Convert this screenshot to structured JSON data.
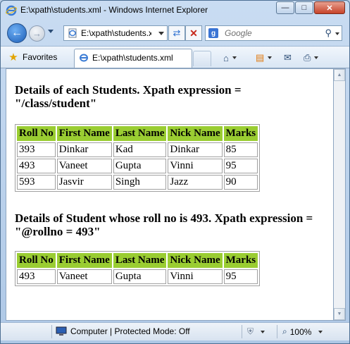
{
  "window": {
    "title": "E:\\xpath\\students.xml - Windows Internet Explorer",
    "minimize_icon": "minimize-icon",
    "maximize_icon": "maximize-icon",
    "close_icon": "close-icon"
  },
  "nav": {
    "address": "E:\\xpath\\students.x",
    "search_placeholder": "Google",
    "search_provider_icon": "google-icon"
  },
  "favbar": {
    "favorites_label": "Favorites",
    "tab_title": "E:\\xpath\\students.xml"
  },
  "page": {
    "heading1": "Details of each Students. Xpath expression = \"/class/student\"",
    "heading2": "Details of Student whose roll no is 493. Xpath expression = \"@rollno = 493\"",
    "table_headers": [
      "Roll No",
      "First Name",
      "Last Name",
      "Nick Name",
      "Marks"
    ],
    "table1_rows": [
      [
        "393",
        "Dinkar",
        "Kad",
        "Dinkar",
        "85"
      ],
      [
        "493",
        "Vaneet",
        "Gupta",
        "Vinni",
        "95"
      ],
      [
        "593",
        "Jasvir",
        "Singh",
        "Jazz",
        "90"
      ]
    ],
    "table2_rows": [
      [
        "493",
        "Vaneet",
        "Gupta",
        "Vinni",
        "95"
      ]
    ],
    "header_color": "#9acd32"
  },
  "status": {
    "zone_text": "Computer | Protected Mode: Off",
    "zoom": "100%"
  }
}
